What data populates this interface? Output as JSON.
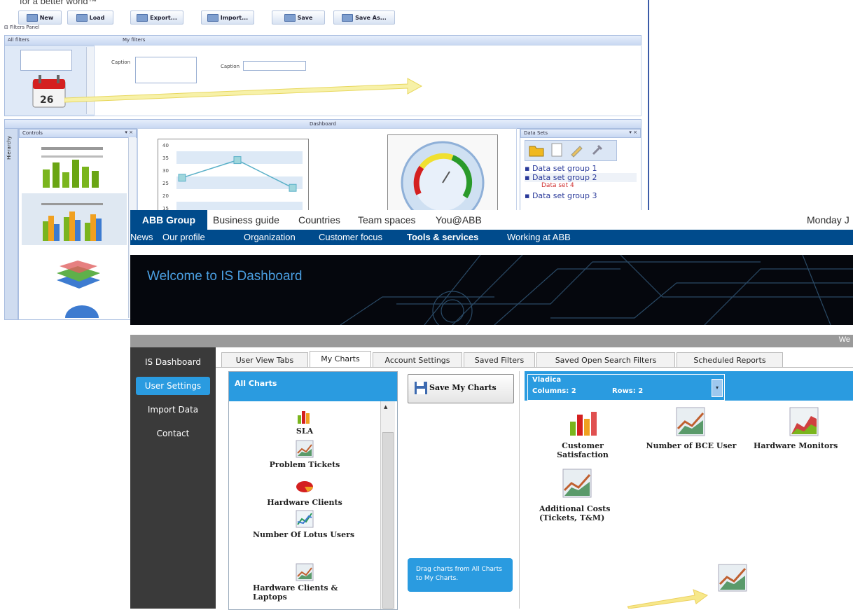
{
  "designer": {
    "tagline": "for a better world™",
    "toolbar": [
      "New",
      "Load",
      "Export...",
      "Import...",
      "Save",
      "Save As..."
    ],
    "filters_panel_label": "Filters Panel",
    "all_filters": "All filters",
    "my_filters": "My filters",
    "caption_1": "Caption",
    "caption_2": "Caption",
    "calendar_day": "26",
    "dashboard_title": "Dashboard",
    "controls_title": "Controls",
    "side_tab": "Hierarchy",
    "data_sets_title": "Data Sets",
    "data_sets": [
      "Data set group 1",
      "Data set group 2",
      "Data set 4",
      "Data set group 3"
    ],
    "line_chart": {
      "y_ticks": [
        "40",
        "35",
        "30",
        "25",
        "20",
        "15"
      ],
      "points": [
        27,
        34,
        23
      ]
    }
  },
  "abb": {
    "top_nav": [
      "ABB Group",
      "Business guide",
      "Countries",
      "Team spaces",
      "You@ABB"
    ],
    "date_label": "Monday J",
    "sub_nav": [
      "News",
      "Our profile",
      "Organization",
      "Customer focus",
      "Tools & services",
      "Working at ABB"
    ],
    "hero_title": "Welcome to IS Dashboard",
    "grey_bar_text": "We",
    "left_nav": [
      "IS Dashboard",
      "User Settings",
      "Import Data",
      "Contact"
    ],
    "tabs": [
      "User View Tabs",
      "My Charts",
      "Account Settings",
      "Saved Filters",
      "Saved Open Search Filters",
      "Scheduled Reports"
    ],
    "all_charts_title": "All Charts",
    "all_charts": [
      "SLA",
      "Problem Tickets",
      "Hardware Clients",
      "Number Of Lotus Users",
      "Hardware Clients & Laptops"
    ],
    "save_button": "Save My Charts",
    "hint": "Drag charts from All Charts to My Charts.",
    "view_select": {
      "name": "Vladica",
      "columns": "Columns: 2",
      "rows": "Rows: 2"
    },
    "my_charts": [
      "Customer Satisfaction",
      "Number of BCE User",
      "Hardware Monitors",
      "Additional Costs (Tickets, T&M)"
    ]
  },
  "colors": {
    "abb_blue": "#004b8c",
    "accent_blue": "#2a9be0",
    "nav_dark": "#3a3a3a"
  }
}
